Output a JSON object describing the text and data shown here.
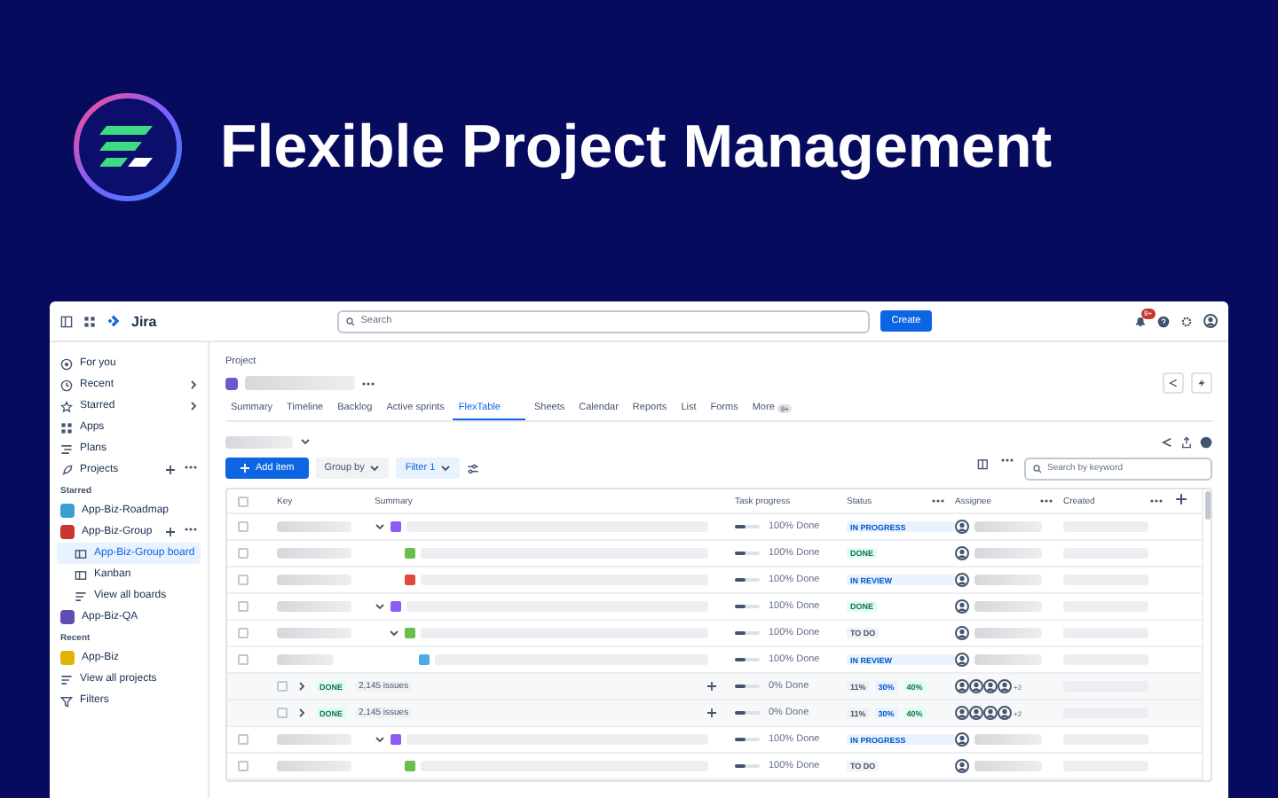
{
  "header": {
    "title": "Flexible Project Management"
  },
  "topbar": {
    "app_name": "Jira",
    "search": {
      "placeholder": "Search"
    },
    "create_button": "Create",
    "notification_badge": "9+"
  },
  "sidebar": {
    "items": [
      {
        "kind": "nav",
        "label": "For you",
        "selected": false
      },
      {
        "kind": "nav",
        "label": "Recent",
        "has_submenu": true,
        "selected": false
      },
      {
        "kind": "nav",
        "label": "Starred",
        "has_submenu": true,
        "selected": false
      },
      {
        "kind": "nav",
        "label": "Apps",
        "selected": false
      },
      {
        "kind": "nav",
        "label": "Plans",
        "selected": false
      },
      {
        "kind": "nav",
        "label": "Projects",
        "has_actions": true,
        "selected": false
      },
      {
        "kind": "section",
        "label": "Starred"
      },
      {
        "kind": "project",
        "label": "App-Biz-Roadmap",
        "color": "#3a9fd0",
        "selected": false
      },
      {
        "kind": "project",
        "label": "App-Biz-Group",
        "color": "#c9372c",
        "has_actions": true,
        "selected": false,
        "children": [
          {
            "kind": "board",
            "label": "App-Biz-Group board",
            "selected": true
          },
          {
            "kind": "board",
            "label": "Kanban",
            "selected": false
          },
          {
            "kind": "link",
            "label": "View all boards",
            "selected": false
          }
        ]
      },
      {
        "kind": "project",
        "label": "App-Biz-QA",
        "color": "#5e4db2",
        "selected": false
      },
      {
        "kind": "section",
        "label": "Recent"
      },
      {
        "kind": "project",
        "label": "App-Biz",
        "color": "#e2b203",
        "selected": false
      },
      {
        "kind": "link",
        "label": "View all projects",
        "selected": false
      },
      {
        "kind": "nav",
        "label": "Filters",
        "selected": false
      }
    ]
  },
  "main": {
    "breadcrumb": "Project",
    "tabs": [
      {
        "label": "Summary",
        "selected": false
      },
      {
        "label": "Timeline",
        "selected": false
      },
      {
        "label": "Backlog",
        "selected": false
      },
      {
        "label": "Active sprints",
        "selected": false
      },
      {
        "label": "FlexTable",
        "selected": true
      },
      {
        "label": "Sheets",
        "selected": false
      },
      {
        "label": "Calendar",
        "selected": false
      },
      {
        "label": "Reports",
        "selected": false
      },
      {
        "label": "List",
        "selected": false
      },
      {
        "label": "Forms",
        "selected": false
      },
      {
        "label": "More",
        "badge": "9+",
        "selected": false
      }
    ],
    "toolbar": {
      "add_button": "Add item",
      "group_by": "Group by",
      "filter": {
        "label": "Filter",
        "count": "1"
      },
      "search": {
        "placeholder": "Search by keyword"
      }
    },
    "table": {
      "select_all": {
        "checked": false
      },
      "columns": [
        {
          "label": "Key",
          "has_menu": false
        },
        {
          "label": "Summary",
          "has_menu": false
        },
        {
          "label": "Task progress",
          "has_menu": false
        },
        {
          "label": "Status",
          "has_menu": true
        },
        {
          "label": "Assignee",
          "has_menu": true
        },
        {
          "label": "Created",
          "has_menu": true
        }
      ],
      "rows": [
        {
          "kind": "epic",
          "checked": false,
          "expanded": true,
          "progress": {
            "text": "100% Done",
            "level": 0.45
          },
          "status": {
            "text": "IN PROGRESS",
            "kind": "progress"
          },
          "children": [
            {
              "kind": "story",
              "checked": false,
              "progress": {
                "text": "100% Done",
                "level": 0.45
              },
              "status": {
                "text": "DONE",
                "kind": "done"
              }
            },
            {
              "kind": "bug",
              "checked": false,
              "progress": {
                "text": "100% Done",
                "level": 0.45
              },
              "status": {
                "text": "IN REVIEW",
                "kind": "progress"
              }
            }
          ]
        },
        {
          "kind": "epic",
          "checked": false,
          "expanded": true,
          "progress": {
            "text": "100% Done",
            "level": 0.45
          },
          "status": {
            "text": "DONE",
            "kind": "done"
          },
          "children": [
            {
              "kind": "story",
              "checked": false,
              "expanded": true,
              "progress": {
                "text": "100% Done",
                "level": 0.45
              },
              "status": {
                "text": "TO DO",
                "kind": "todo"
              },
              "children": [
                {
                  "kind": "subtask",
                  "checked": false,
                  "progress": {
                    "text": "100% Done",
                    "level": 0.45
                  },
                  "status": {
                    "text": "IN REVIEW",
                    "kind": "progress"
                  }
                }
              ]
            }
          ]
        },
        {
          "kind": "group",
          "checked": false,
          "expanded": false,
          "status": {
            "text": "DONE",
            "kind": "done"
          },
          "count": "2,145 issues",
          "progress": {
            "text": "0% Done",
            "level": 0.45
          },
          "shares": [
            {
              "text": "11%",
              "kind": "todo"
            },
            {
              "text": "30%",
              "kind": "progress"
            },
            {
              "text": "40%",
              "kind": "done"
            }
          ],
          "more_assignees": "+2"
        },
        {
          "kind": "group",
          "checked": false,
          "expanded": false,
          "status": {
            "text": "DONE",
            "kind": "done"
          },
          "count": "2,145 issues",
          "progress": {
            "text": "0% Done",
            "level": 0.45
          },
          "shares": [
            {
              "text": "11%",
              "kind": "todo"
            },
            {
              "text": "30%",
              "kind": "progress"
            },
            {
              "text": "40%",
              "kind": "done"
            }
          ],
          "more_assignees": "+2"
        },
        {
          "kind": "epic",
          "checked": false,
          "expanded": true,
          "progress": {
            "text": "100% Done",
            "level": 0.45
          },
          "status": {
            "text": "IN PROGRESS",
            "kind": "progress"
          },
          "children": [
            {
              "kind": "story",
              "checked": false,
              "progress": {
                "text": "100% Done",
                "level": 0.45
              },
              "status": {
                "text": "TO DO",
                "kind": "todo"
              }
            }
          ]
        }
      ]
    }
  }
}
